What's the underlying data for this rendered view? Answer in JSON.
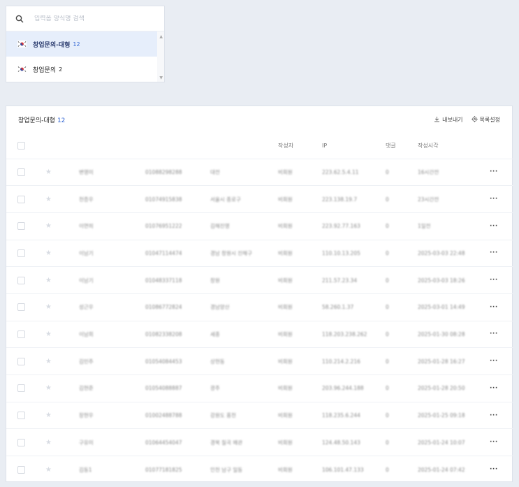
{
  "search": {
    "placeholder": "입력폼 양식명 검색"
  },
  "forms": [
    {
      "name": "창업문의-대형",
      "count": "12",
      "active": true
    },
    {
      "name": "창업문의",
      "count": "2",
      "active": false
    }
  ],
  "panel": {
    "title": "창업문의-대형",
    "count": "12",
    "export_label": "내보내기",
    "settings_label": "목록설정"
  },
  "table": {
    "columns": [
      "",
      "",
      "",
      "",
      "",
      "작성자",
      "IP",
      "댓글",
      "작성시각",
      ""
    ],
    "rows": [
      {
        "name": "변영미",
        "phone": "01088298288",
        "region": "대전",
        "writer": "비회원",
        "ip": "223.62.5.4.11",
        "comments": "0",
        "time": "16시간전"
      },
      {
        "name": "천증우",
        "phone": "01074915838",
        "region": "서울시 종로구",
        "writer": "비회원",
        "ip": "223.138.19.7",
        "comments": "0",
        "time": "23시간전"
      },
      {
        "name": "이연히",
        "phone": "01076951222",
        "region": "김해진영",
        "writer": "비회원",
        "ip": "223.92.77.163",
        "comments": "0",
        "time": "1일전"
      },
      {
        "name": "이남기",
        "phone": "01047114474",
        "region": "경남 창원시 진해구",
        "writer": "비회원",
        "ip": "110.10.13.205",
        "comments": "0",
        "time": "2025-03-03 22:48"
      },
      {
        "name": "이남기",
        "phone": "01048337118",
        "region": "창원",
        "writer": "비회원",
        "ip": "211.57.23.34",
        "comments": "0",
        "time": "2025-03-03 18:26"
      },
      {
        "name": "성근우",
        "phone": "01086772824",
        "region": "경남양산",
        "writer": "비회원",
        "ip": "58.260.1.37",
        "comments": "0",
        "time": "2025-03-01 14:49"
      },
      {
        "name": "이남희",
        "phone": "01082338208",
        "region": "세종",
        "writer": "비회원",
        "ip": "118.203.238.262",
        "comments": "0",
        "time": "2025-01-30 08:28"
      },
      {
        "name": "김민주",
        "phone": "01054084453",
        "region": "상현동",
        "writer": "비회원",
        "ip": "110.214.2.216",
        "comments": "0",
        "time": "2025-01-28 16:27"
      },
      {
        "name": "김현준",
        "phone": "01054088887",
        "region": "광주",
        "writer": "비회원",
        "ip": "203.96.244.188",
        "comments": "0",
        "time": "2025-01-28 20:50"
      },
      {
        "name": "장현우",
        "phone": "01002488788",
        "region": "강원도 홍천",
        "writer": "비회원",
        "ip": "118.235.6.244",
        "comments": "0",
        "time": "2025-01-25 09:18"
      },
      {
        "name": "구유미",
        "phone": "01064454047",
        "region": "경북 칠곡 왜관",
        "writer": "비회원",
        "ip": "124.48.50.143",
        "comments": "0",
        "time": "2025-01-24 10:07"
      },
      {
        "name": "김동1",
        "phone": "01077181825",
        "region": "인천 남구 일동",
        "writer": "비회원",
        "ip": "106.101.47.133",
        "comments": "0",
        "time": "2025-01-24 07:42"
      }
    ]
  },
  "colors": {
    "accent": "#3568d4",
    "active_bg": "#e6eefb",
    "page_bg": "#e9edf3"
  },
  "icons": {
    "search": "search-icon",
    "flag": "korea-flag-icon",
    "export": "download-icon",
    "settings": "gear-icon",
    "star": "star-icon",
    "more": "more-icon"
  }
}
